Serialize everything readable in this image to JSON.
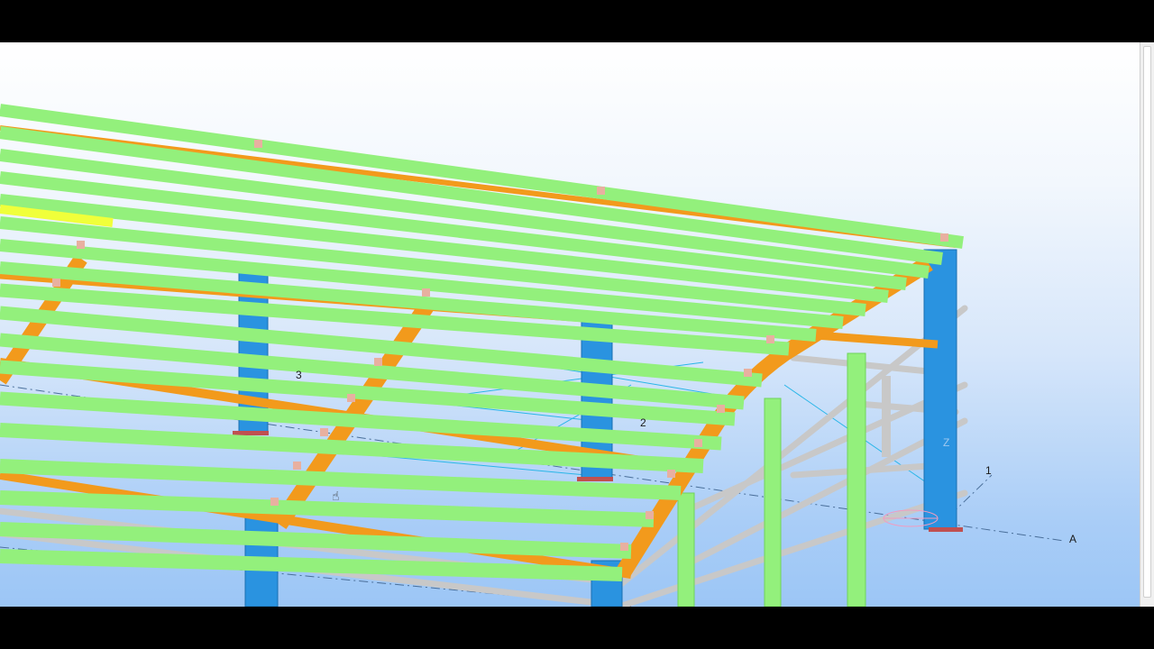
{
  "viewport": {
    "labels": {
      "grid_3": "3",
      "grid_2": "2",
      "grid_1": "1",
      "grid_A": "A",
      "axis_z": "Z"
    },
    "colors": {
      "purlin": "#93f07c",
      "purlin_dark": "#6fd35a",
      "rafter": "#f29a1c",
      "column": "#2a93e0",
      "bracing": "#c9c9c9",
      "selected": "#f0ff3a",
      "background_top": "#ffffff",
      "background_bottom": "#9cc6f6"
    },
    "cursor_icon": "hand-cursor-icon"
  }
}
